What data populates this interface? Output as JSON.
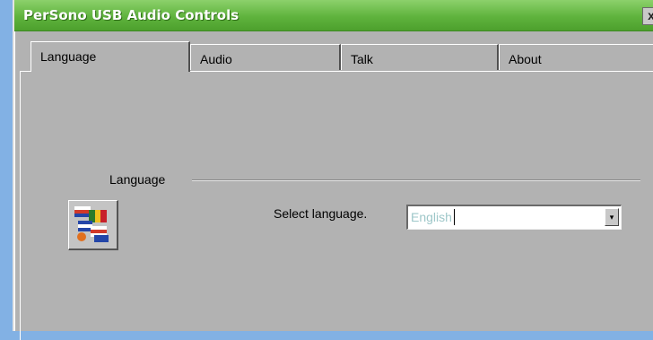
{
  "window": {
    "title": "PerSono USB Audio Controls",
    "close_glyph": "x"
  },
  "tabs": [
    {
      "label": "Language",
      "active": true
    },
    {
      "label": "Audio",
      "active": false
    },
    {
      "label": "Talk",
      "active": false
    },
    {
      "label": "About",
      "active": false
    }
  ],
  "language_group": {
    "label": "Language",
    "icon": "language-flags-icon",
    "select_label": "Select language.",
    "selected_value": "English",
    "dropdown_glyph": "▾"
  },
  "colors": {
    "titlebar": "#5fb33d",
    "panel": "#b2b2b2",
    "desktop": "#82b1e4"
  }
}
